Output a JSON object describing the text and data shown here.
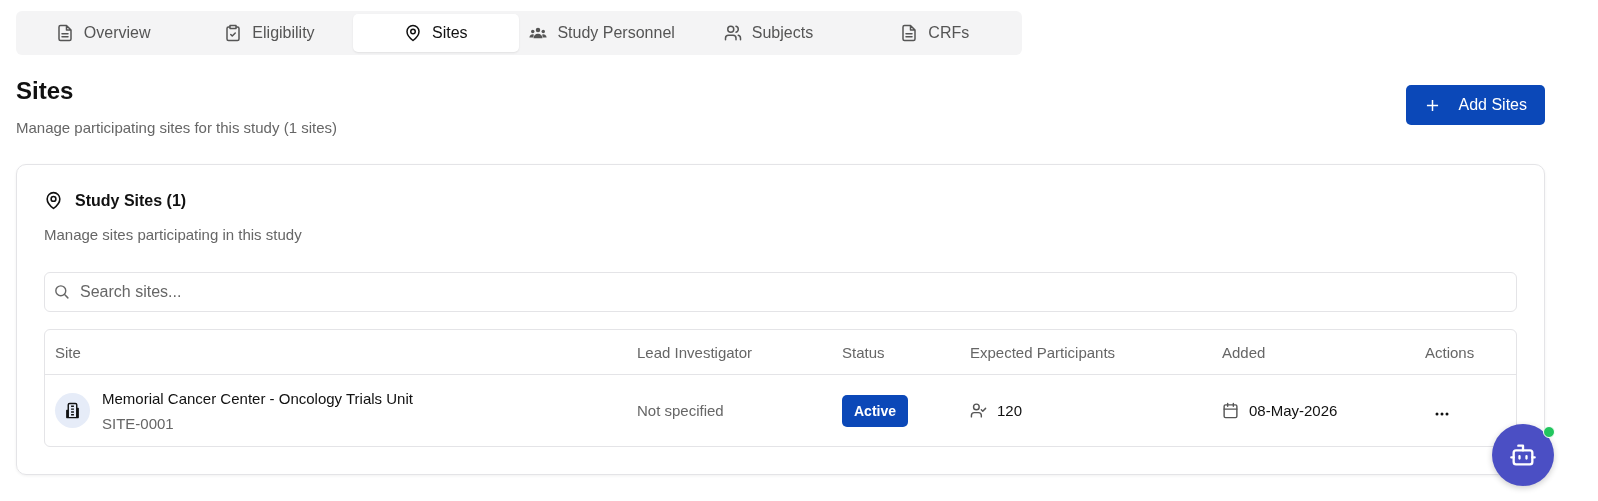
{
  "tabs": [
    {
      "label": "Overview",
      "selected": false
    },
    {
      "label": "Eligibility",
      "selected": false
    },
    {
      "label": "Sites",
      "selected": true
    },
    {
      "label": "Study Personnel",
      "selected": false
    },
    {
      "label": "Subjects",
      "selected": false
    },
    {
      "label": "CRFs",
      "selected": false
    }
  ],
  "header": {
    "title": "Sites",
    "subtitle": "Manage participating sites for this study (1 sites)",
    "add_button": "Add Sites"
  },
  "card": {
    "title": "Study Sites (1)",
    "subtitle": "Manage sites participating in this study",
    "search": {
      "placeholder": "Search sites..."
    },
    "table": {
      "columns": [
        "Site",
        "Lead Investigator",
        "Status",
        "Expected Participants",
        "Added",
        "Actions"
      ],
      "rows": [
        {
          "site": "Memorial Cancer Center - Oncology Trials Unit",
          "code": "SITE-0001",
          "lead_investigator": "Not specified",
          "status": "Active",
          "expected_participants": "120",
          "added": "08-May-2026"
        }
      ]
    }
  },
  "assistant": {
    "online": true
  }
}
